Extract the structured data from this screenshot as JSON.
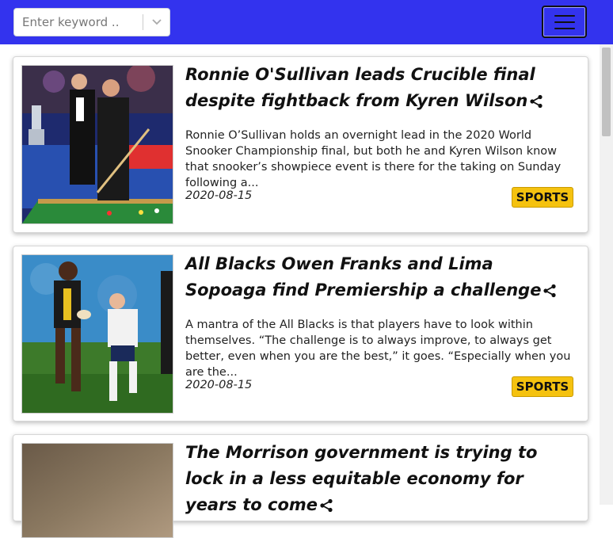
{
  "search": {
    "placeholder": "Enter keyword .."
  },
  "icons": {
    "dropdown": "chevron-down-icon",
    "menu": "hamburger-menu-icon",
    "share": "share-icon"
  },
  "colors": {
    "navbar": "#3333ee",
    "badge": "#f5c20f"
  },
  "articles": [
    {
      "title": "Ronnie O'Sullivan leads Crucible final despite fightback from Kyren Wilson",
      "summary": "Ronnie O’Sullivan holds an overnight lead in the 2020 World Snooker Championship final, but both he and Kyren Wilson know that snooker’s showpiece event is there for the taking on Sunday following a...",
      "date": "2020-08-15",
      "category": "SPORTS"
    },
    {
      "title": "All Blacks Owen Franks and Lima Sopoaga find Premiership a challenge",
      "summary": "A mantra of the All Blacks is that players have to look within themselves. “The challenge is to always improve, to always get better, even when you are the best,” it goes. “Especially when you are the...",
      "date": "2020-08-15",
      "category": "SPORTS"
    },
    {
      "title": "The Morrison government is trying to lock in a less equitable economy for years to come",
      "summary": "",
      "date": "",
      "category": ""
    }
  ]
}
